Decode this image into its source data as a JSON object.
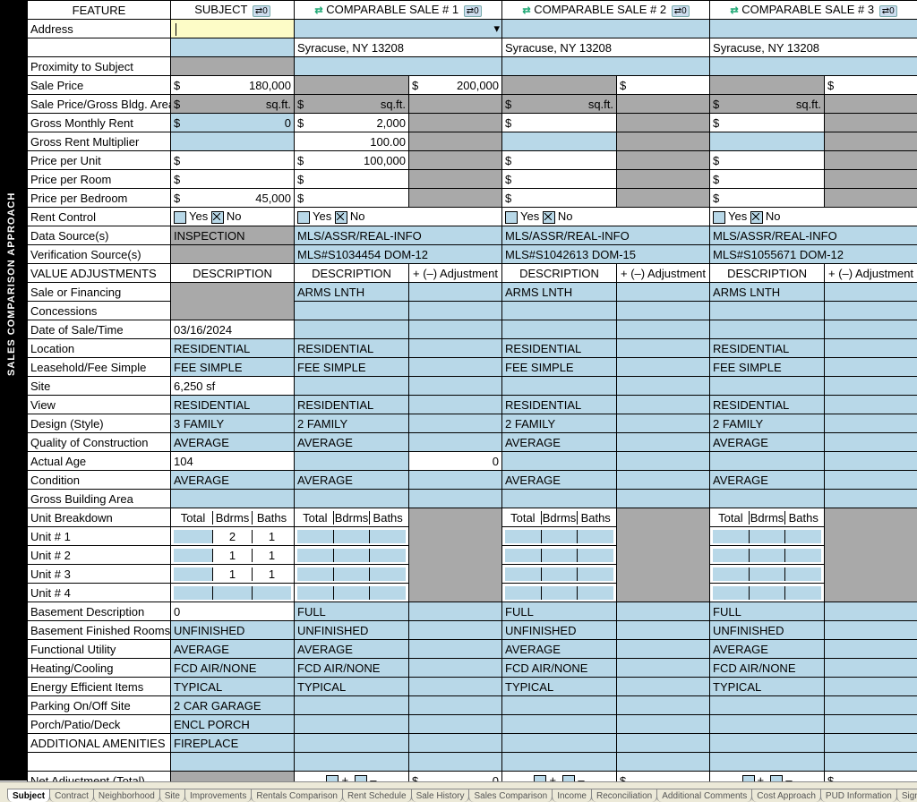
{
  "headers": {
    "feature": "FEATURE",
    "subject": "SUBJECT",
    "comp1": "COMPARABLE SALE # 1",
    "comp2": "COMPARABLE SALE # 2",
    "comp3": "COMPARABLE SALE # 3",
    "badge": "0"
  },
  "rows": {
    "address_label": "Address",
    "city1": "Syracuse, NY 13208",
    "city2": "Syracuse, NY 13208",
    "city3": "Syracuse, NY 13208",
    "proximity": "Proximity to Subject",
    "sale_price": "Sale Price",
    "sale_price_subj": "180,000",
    "sale_price_c1": "200,000",
    "sp_area": "Sale Price/Gross Bldg. Area",
    "sqft": "sq.ft.",
    "gmr": "Gross Monthly Rent",
    "gmr_subj": "0",
    "gmr_c1": "2,000",
    "grm": "Gross Rent Multiplier",
    "grm_c1": "100.00",
    "ppu": "Price per Unit",
    "ppu_c1": "100,000",
    "ppr": "Price per Room",
    "ppb": "Price per Bedroom",
    "ppb_subj": "45,000",
    "dollar": "$",
    "rent_control": "Rent Control",
    "yes": "Yes",
    "no": "No",
    "data_src": "Data Source(s)",
    "data_src_subj": "INSPECTION",
    "data_src_c": "MLS/ASSR/REAL-INFO",
    "verif": "Verification Source(s)",
    "verif_c1": "MLS#S1034454   DOM-12",
    "verif_c2": "MLS#S1042613   DOM-15",
    "verif_c3": "MLS#S1055671   DOM-12",
    "va": "VALUE ADJUSTMENTS",
    "desc": "DESCRIPTION",
    "adj": "+ (–) Adjustment",
    "sfc": "Sale or Financing",
    "conc": "Concessions",
    "arms": "ARMS LNTH",
    "dot": "Date of Sale/Time",
    "dot_subj": "03/16/2024",
    "loc": "Location",
    "residential": "RESIDENTIAL",
    "lfs": "Leasehold/Fee Simple",
    "fee": "FEE SIMPLE",
    "site": "Site",
    "site_subj": "6,250 sf",
    "view": "View",
    "design": "Design (Style)",
    "design_subj": "3 FAMILY",
    "design_c": "2 FAMILY",
    "qoc": "Quality of Construction",
    "avg": "AVERAGE",
    "age": "Actual Age",
    "age_subj": "104",
    "age_c1_adj": "0",
    "cond": "Condition",
    "gba": "Gross Building Area",
    "ub": "Unit Breakdown",
    "total": "Total",
    "bdrms": "Bdrms",
    "baths": "Baths",
    "u1": "Unit # 1",
    "u1b": "2",
    "u1ba": "1",
    "u2": "Unit # 2",
    "u2b": "1",
    "u2ba": "1",
    "u3": "Unit # 3",
    "u3b": "1",
    "u3ba": "1",
    "u4": "Unit # 4",
    "bdesc": "Basement Description",
    "bd_subj": "0",
    "bd_c": "FULL",
    "bfr": "Basement Finished Rooms",
    "unfin": "UNFINISHED",
    "fu": "Functional Utility",
    "hc": "Heating/Cooling",
    "hc_v": "FCD AIR/NONE",
    "eei": "Energy Efficient Items",
    "typ": "TYPICAL",
    "park": "Parking On/Off Site",
    "park_subj": "2 CAR GARAGE",
    "ppd": "Porch/Patio/Deck",
    "ppd_subj": "ENCL PORCH",
    "aa": "ADDITIONAL AMENITIES",
    "aa_subj": "FIREPLACE",
    "nat": "Net Adjustment (Total)",
    "nat_c1_adj": "0",
    "plus": "+",
    "minus": "–"
  },
  "sidebar_label": "SALES COMPARISON APPROACH",
  "tabs": [
    "Subject",
    "Contract",
    "Neighborhood",
    "Site",
    "Improvements",
    "Rentals Comparison",
    "Rent Schedule",
    "Sale History",
    "Sales Comparison",
    "Income",
    "Reconciliation",
    "Additional Comments",
    "Cost Approach",
    "PUD Information",
    "Signatures"
  ],
  "active_tab": "Subject"
}
